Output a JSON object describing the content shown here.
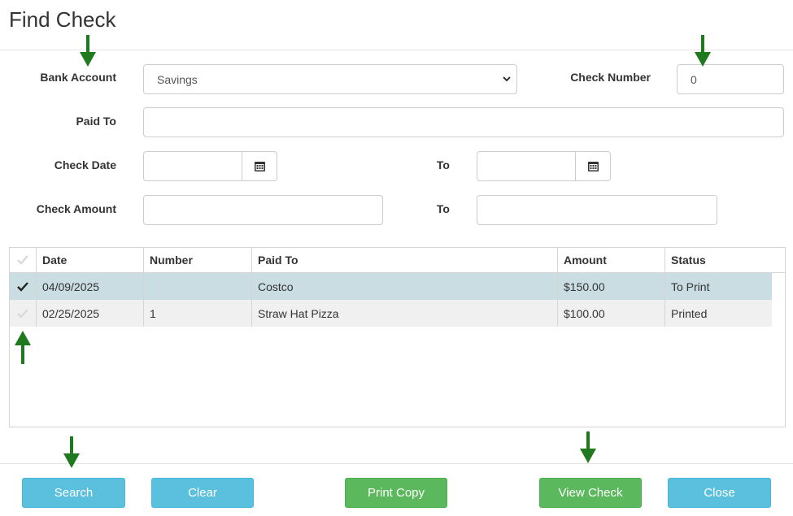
{
  "dialog": {
    "title": "Find Check"
  },
  "form": {
    "bank_account_label": "Bank Account",
    "bank_account_value": "Savings",
    "check_number_label": "Check Number",
    "check_number_value": "0",
    "paid_to_label": "Paid To",
    "paid_to_value": "",
    "check_date_label": "Check Date",
    "check_date_from": "",
    "check_date_to_label": "To",
    "check_date_to": "",
    "check_amount_label": "Check Amount",
    "check_amount_from": "",
    "check_amount_to_label": "To",
    "check_amount_to": ""
  },
  "grid": {
    "columns": [
      "Date",
      "Number",
      "Paid To",
      "Amount",
      "Status"
    ],
    "rows": [
      {
        "selected": true,
        "date": "04/09/2025",
        "number": "",
        "paid_to": "Costco",
        "amount": "$150.00",
        "status": "To Print"
      },
      {
        "selected": false,
        "date": "02/25/2025",
        "number": "1",
        "paid_to": "Straw Hat Pizza",
        "amount": "$100.00",
        "status": "Printed"
      }
    ]
  },
  "buttons": {
    "search": "Search",
    "clear": "Clear",
    "print_copy": "Print Copy",
    "view_check": "View Check",
    "close": "Close"
  },
  "colors": {
    "info_button": "#5bc0de",
    "success_button": "#5cb85c",
    "selected_row": "#c9dde3",
    "annotation_arrow": "#1f7a1f"
  },
  "icons": {
    "calendar": "calendar-icon",
    "dropdown": "chevron-down-icon",
    "check": "checkmark-icon",
    "annotation": "arrow-icon"
  }
}
